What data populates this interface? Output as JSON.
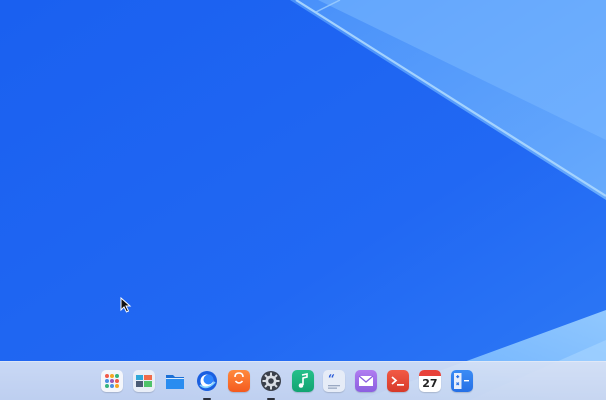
{
  "desktop": {
    "background_colors": [
      "#1e66f2",
      "#5aa6fb",
      "#8cc7ff"
    ]
  },
  "dock": {
    "items": [
      {
        "name": "launcher",
        "icon": "app-grid-icon",
        "running": false
      },
      {
        "name": "multitasking-view",
        "icon": "workspaces-icon",
        "running": false
      },
      {
        "name": "file-manager",
        "icon": "folder-icon",
        "running": false
      },
      {
        "name": "browser",
        "icon": "browser-icon",
        "running": true
      },
      {
        "name": "app-store",
        "icon": "shopping-bag-icon",
        "running": false
      },
      {
        "name": "settings",
        "icon": "gear-icon",
        "running": true
      },
      {
        "name": "music",
        "icon": "music-note-icon",
        "running": false
      },
      {
        "name": "text-editor",
        "icon": "quote-document-icon",
        "running": false
      },
      {
        "name": "mail",
        "icon": "mail-icon",
        "running": false
      },
      {
        "name": "terminal",
        "icon": "terminal-icon",
        "running": false
      },
      {
        "name": "calendar",
        "icon": "calendar-icon",
        "running": false,
        "day": "27"
      },
      {
        "name": "calculator",
        "icon": "calculator-icon",
        "running": false
      }
    ]
  }
}
